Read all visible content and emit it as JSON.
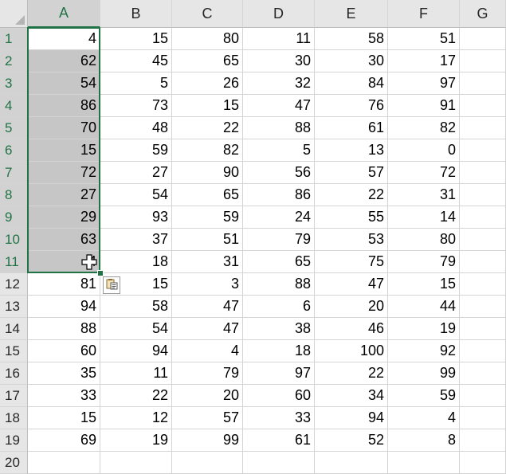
{
  "columns": [
    "A",
    "B",
    "C",
    "D",
    "E",
    "F",
    "G"
  ],
  "rows": [
    [
      "1",
      "4",
      "15",
      "80",
      "11",
      "58",
      "51"
    ],
    [
      "2",
      "62",
      "45",
      "65",
      "30",
      "30",
      "17"
    ],
    [
      "3",
      "54",
      "5",
      "26",
      "32",
      "84",
      "97"
    ],
    [
      "4",
      "86",
      "73",
      "15",
      "47",
      "76",
      "91"
    ],
    [
      "5",
      "70",
      "48",
      "22",
      "88",
      "61",
      "82"
    ],
    [
      "6",
      "15",
      "59",
      "82",
      "5",
      "13",
      "0"
    ],
    [
      "7",
      "72",
      "27",
      "90",
      "56",
      "57",
      "72"
    ],
    [
      "8",
      "27",
      "54",
      "65",
      "86",
      "22",
      "31"
    ],
    [
      "9",
      "29",
      "93",
      "59",
      "24",
      "55",
      "14"
    ],
    [
      "10",
      "63",
      "37",
      "51",
      "79",
      "53",
      "80"
    ],
    [
      "11",
      "4",
      "18",
      "31",
      "65",
      "75",
      "79"
    ],
    [
      "12",
      "81",
      "15",
      "3",
      "88",
      "47",
      "15"
    ],
    [
      "13",
      "94",
      "58",
      "47",
      "6",
      "20",
      "44"
    ],
    [
      "14",
      "88",
      "54",
      "47",
      "38",
      "46",
      "19"
    ],
    [
      "15",
      "60",
      "94",
      "4",
      "18",
      "100",
      "92"
    ],
    [
      "16",
      "35",
      "11",
      "79",
      "97",
      "22",
      "99"
    ],
    [
      "17",
      "33",
      "22",
      "20",
      "60",
      "34",
      "59"
    ],
    [
      "18",
      "15",
      "12",
      "57",
      "33",
      "94",
      "4"
    ],
    [
      "19",
      "69",
      "19",
      "99",
      "61",
      "52",
      "8"
    ],
    [
      "20",
      "",
      "",
      "",
      "",
      "",
      ""
    ]
  ],
  "selection": {
    "column": "A",
    "first_row": 1,
    "last_row": 11,
    "active_cell": "A1"
  },
  "colors": {
    "accent": "#217346",
    "selected_fill": "#c6c6c6",
    "header_fill": "#e6e6e6",
    "gridline": "#d4d4d4"
  },
  "icons": {
    "paste_options": "paste-options-icon",
    "cursor": "fill-cross-cursor-icon",
    "corner": "select-all-triangle-icon"
  }
}
